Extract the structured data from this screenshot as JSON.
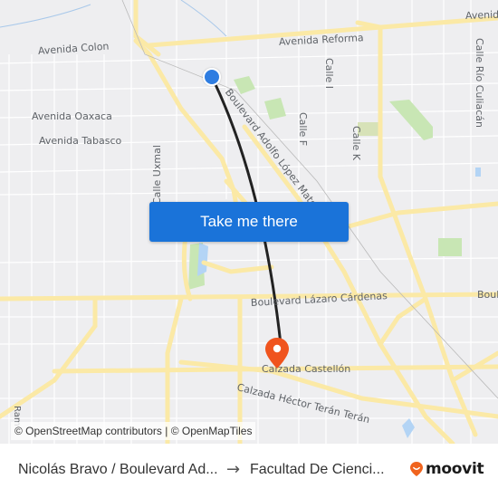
{
  "map": {
    "street_labels": [
      {
        "id": "avenida-colon",
        "text": "Avenida Colon"
      },
      {
        "id": "avenida-reforma",
        "text": "Avenida Reforma"
      },
      {
        "id": "avenida-top-right",
        "text": "Avenida"
      },
      {
        "id": "calle-i",
        "text": "Calle I"
      },
      {
        "id": "calle-rio-culiacan",
        "text": "Calle Río Culiacán"
      },
      {
        "id": "avenida-oaxaca",
        "text": "Avenida Oaxaca"
      },
      {
        "id": "avenida-tabasco",
        "text": "Avenida Tabasco"
      },
      {
        "id": "boulevard-adolfo-lopez-mateos",
        "text": "Boulevard Adolfo López Mateos"
      },
      {
        "id": "calle-f",
        "text": "Calle F"
      },
      {
        "id": "calle-k",
        "text": "Calle K"
      },
      {
        "id": "calle-uxmal",
        "text": "Calle Uxmal"
      },
      {
        "id": "boulevard-lazaro-cardenas",
        "text": "Boulevard Lázaro Cárdenas"
      },
      {
        "id": "boulevard-right",
        "text": "Boul"
      },
      {
        "id": "calzada-castellon",
        "text": "Calzada Castellón"
      },
      {
        "id": "calzada-hector-teran-teran",
        "text": "Calzada Héctor Terán Terán"
      },
      {
        "id": "ramal-left",
        "text": "Ram"
      }
    ],
    "cta_label": "Take me there",
    "attribution": "© OpenStreetMap contributors | © OpenMapTiles",
    "colors": {
      "background": "#eeeef0",
      "major_road": "#fbe9a6",
      "minor_road": "#ffffff",
      "park": "#c8e6b4",
      "water": "#b3d4f5",
      "route_line": "#222222",
      "origin_marker": "#2f7de1",
      "destination_marker": "#f0541e",
      "cta_background": "#1a73d9"
    }
  },
  "footer": {
    "origin": "Nicolás Bravo / Boulevard Ad...",
    "arrow": "→",
    "destination": "Facultad De Cienci...",
    "brand": "moovit",
    "brand_color": "#f0641e"
  }
}
